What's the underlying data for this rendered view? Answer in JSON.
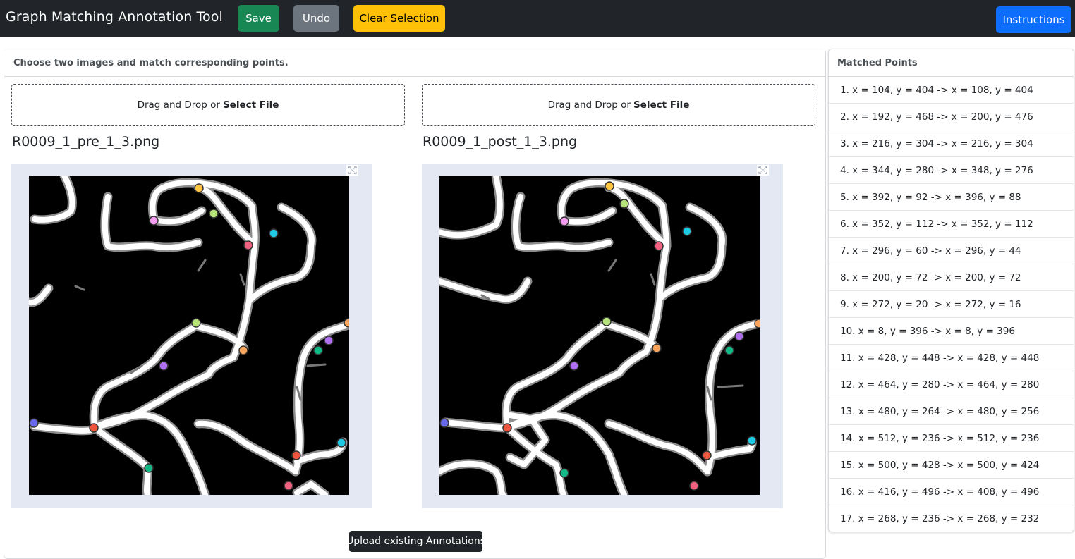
{
  "header": {
    "title": "Graph Matching Annotation Tool",
    "save_label": "Save",
    "undo_label": "Undo",
    "clear_label": "Clear Selection",
    "instructions_label": "Instructions"
  },
  "main": {
    "card_title": "Choose two images and match corresponding points.",
    "dropzone_prefix": "Drag and Drop or",
    "dropzone_action": "Select File",
    "left_file": "R0009_1_pre_1_3.png",
    "right_file": "R0009_1_post_1_3.png",
    "upload_label": "Upload existing Annotations"
  },
  "sidebar": {
    "title": "Matched Points",
    "matches": [
      "1. x = 104, y = 404 -> x = 108, y = 404",
      "2. x = 192, y = 468 -> x = 200, y = 476",
      "3. x = 216, y = 304 -> x = 216, y = 304",
      "4. x = 344, y = 280 -> x = 348, y = 276",
      "5. x = 392, y = 92 -> x = 396, y = 88",
      "6. x = 352, y = 112 -> x = 352, y = 112",
      "7. x = 296, y = 60 -> x = 296, y = 44",
      "8. x = 200, y = 72 -> x = 200, y = 72",
      "9. x = 272, y = 20 -> x = 272, y = 16",
      "10. x = 8, y = 396 -> x = 8, y = 396",
      "11. x = 428, y = 448 -> x = 428, y = 448",
      "12. x = 464, y = 280 -> x = 464, y = 280",
      "13. x = 480, y = 264 -> x = 480, y = 256",
      "14. x = 512, y = 236 -> x = 512, y = 236",
      "15. x = 500, y = 428 -> x = 500, y = 424",
      "16. x = 416, y = 496 -> x = 408, y = 496",
      "17. x = 268, y = 236 -> x = 268, y = 232"
    ]
  },
  "colors": {
    "navbar": "#212529",
    "save": "#198754",
    "undo": "#6c757d",
    "clear": "#ffc107",
    "instructions": "#0d6efd",
    "marker_palette": [
      "#ffc542",
      "#b5e37a",
      "#f49cf0",
      "#1ec9e3",
      "#f0607f",
      "#f9a45a",
      "#b06ff0",
      "#12b886",
      "#6a6ae8",
      "#ee553f"
    ]
  }
}
